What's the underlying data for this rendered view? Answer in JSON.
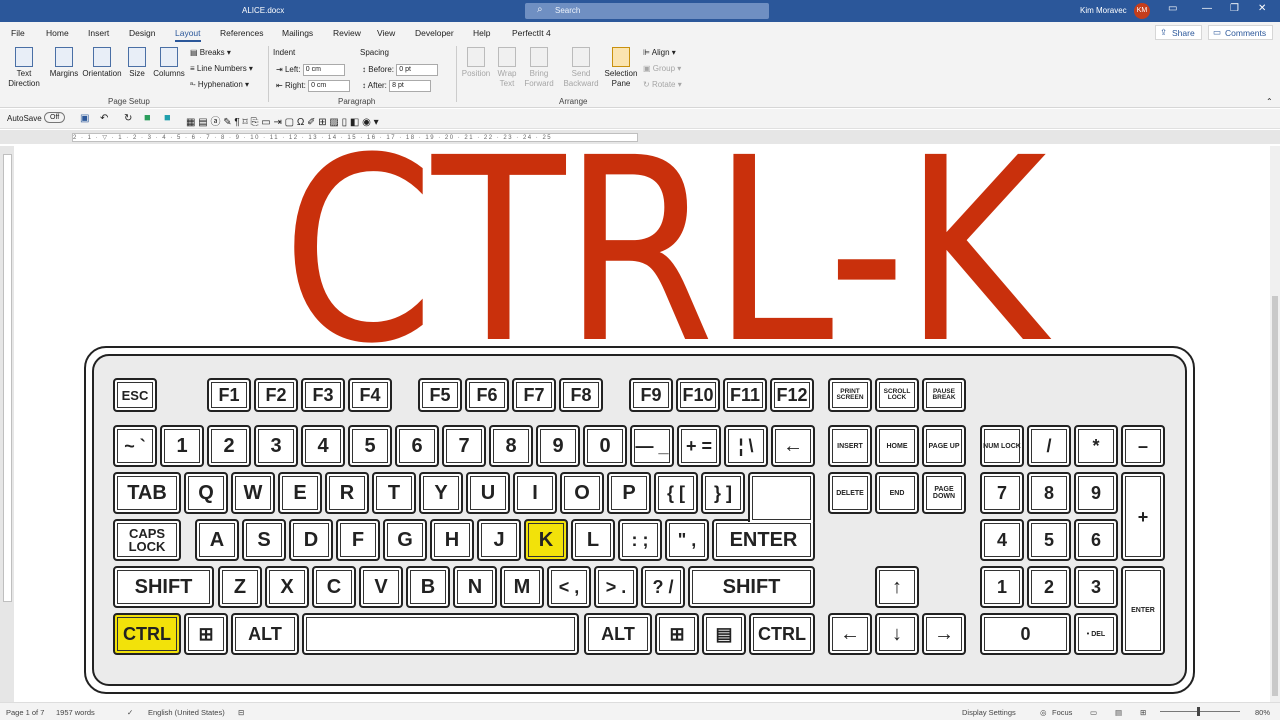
{
  "titlebar": {
    "doc_name": "ALICE.docx",
    "search": "Search",
    "user": "Kim Moravec",
    "initials": "KM"
  },
  "tabs": [
    "File",
    "Home",
    "Insert",
    "Design",
    "Layout",
    "References",
    "Mailings",
    "Review",
    "View",
    "Developer",
    "Help",
    "PerfectIt 4"
  ],
  "share": "Share",
  "comments": "Comments",
  "ribbon": {
    "text_direction": "Text Direction",
    "margins": "Margins",
    "orientation": "Orientation",
    "size": "Size",
    "columns": "Columns",
    "breaks": "Breaks",
    "line_numbers": "Line Numbers",
    "hyphenation": "Hyphenation",
    "page_setup": "Page Setup",
    "indent": "Indent",
    "left": "Left:",
    "right": "Right:",
    "left_val": "0 cm",
    "right_val": "0 cm",
    "spacing": "Spacing",
    "before": "Before:",
    "after": "After:",
    "before_val": "0 pt",
    "after_val": "8 pt",
    "paragraph": "Paragraph",
    "position": "Position",
    "wrap_text": "Wrap Text",
    "bring_forward": "Bring Forward",
    "send_backward": "Send Backward",
    "selection_pane": "Selection Pane",
    "align": "Align",
    "group": "Group",
    "rotate": "Rotate",
    "arrange": "Arrange"
  },
  "qat": {
    "autosave": "AutoSave",
    "autosave_state": "Off"
  },
  "ruler_text": "2 · 1 · ▽ · 1 · 2 · 3 · 4 · 5 · 6 · 7 · 8 · 9 · 10 · 11 · 12 · 13 · 14 · 15 · 16 · 17 · 18 · 19 · 20 · 21 · 22 · 23 · 24 · 25",
  "headline": "CTRL-K",
  "keys": {
    "esc": "ESC",
    "f1": "F1",
    "f2": "F2",
    "f3": "F3",
    "f4": "F4",
    "f5": "F5",
    "f6": "F6",
    "f7": "F7",
    "f8": "F8",
    "f9": "F9",
    "f10": "F10",
    "f11": "F11",
    "f12": "F12",
    "print_screen": "PRINT SCREEN",
    "scroll_lock": "SCROLL LOCK",
    "pause_break": "PAUSE BREAK",
    "tilde": "~ `",
    "n1": "1",
    "n2": "2",
    "n3": "3",
    "n4": "4",
    "n5": "5",
    "n6": "6",
    "n7": "7",
    "n8": "8",
    "n9": "9",
    "n0": "0",
    "minus": "— _",
    "plus": "+ =",
    "pipe": "¦ \\",
    "backspace": "←",
    "insert": "INSERT",
    "home": "HOME",
    "page_up": "PAGE UP",
    "num_lock": "NUM LOCK",
    "slash": "/",
    "star": "*",
    "np_minus": "–",
    "tab": "TAB",
    "q": "Q",
    "w": "W",
    "e": "E",
    "r": "R",
    "t": "T",
    "y": "Y",
    "u": "U",
    "i": "I",
    "o": "O",
    "p": "P",
    "lbrace": "{ [",
    "rbrace": "} ]",
    "delete": "DELETE",
    "end": "END",
    "page_down": "PAGE DOWN",
    "np7": "7",
    "np8": "8",
    "np9": "9",
    "np_plus": "+",
    "caps": "CAPS LOCK",
    "a": "A",
    "s": "S",
    "d": "D",
    "f": "F",
    "g": "G",
    "h": "H",
    "j": "J",
    "k": "K",
    "l": "L",
    "semicolon": ": ;",
    "quote": "\" ,",
    "enter": "ENTER",
    "np4": "4",
    "np5": "5",
    "np6": "6",
    "shift_l": "SHIFT",
    "z": "Z",
    "x": "X",
    "c": "C",
    "v": "V",
    "b": "B",
    "n": "N",
    "m": "M",
    "comma": "< ,",
    "period": "> .",
    "question": "? /",
    "shift_r": "SHIFT",
    "up": "↑",
    "np1": "1",
    "np2": "2",
    "np3": "3",
    "np_enter": "ENTER",
    "ctrl_l": "CTRL",
    "win_l": "⊞",
    "alt_l": "ALT",
    "space": "",
    "alt_r": "ALT",
    "win_r": "⊞",
    "menu": "▤",
    "ctrl_r": "CTRL",
    "left": "←",
    "down": "↓",
    "right": "→",
    "np0": "0",
    "np_del": "• DEL"
  },
  "highlight_color": "#f2e20a",
  "headline_color": "#c9300c",
  "status": {
    "page": "Page 1 of 7",
    "words": "1957 words",
    "lang": "English (United States)",
    "display": "Display Settings",
    "focus": "Focus",
    "zoom": "80%"
  }
}
